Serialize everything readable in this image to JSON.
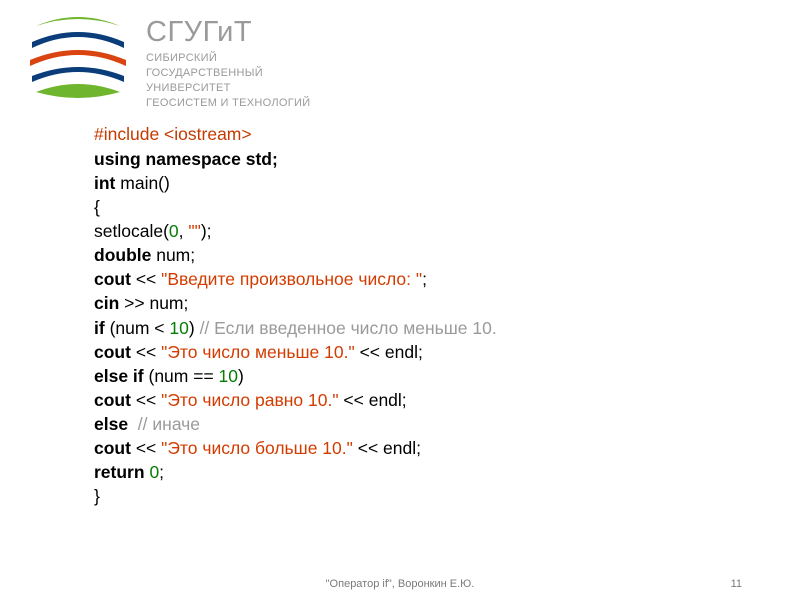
{
  "header": {
    "uni_name": "СГУГиТ",
    "uni_sub_1": "СИБИРСКИЙ",
    "uni_sub_2": "ГОСУДАРСТВЕННЫЙ",
    "uni_sub_3": "УНИВЕРСИТЕТ",
    "uni_sub_4": "ГЕОСИСТЕМ И ТЕХНОЛОГИЙ"
  },
  "code": {
    "l1": "#include <iostream>",
    "l2a": "using namespace std;",
    "l3a": "int",
    "l3b": " main()",
    "l4": "{",
    "l5a": "setlocale(",
    "l5b": "0",
    "l5c": ", ",
    "l5d": "\"\"",
    "l5e": ");",
    "l6a": "double",
    "l6b": " num;",
    "l7a": "cout",
    "l7b": " << ",
    "l7c": "\"Введите произвольное число: \"",
    "l7d": ";",
    "l8a": "cin",
    "l8b": " >> num;",
    "l9a": "if",
    "l9b": " (num < ",
    "l9c": "10",
    "l9d": ") ",
    "l9e": "// Если введенное число меньше 10.",
    "l10a": "cout",
    "l10b": " << ",
    "l10c": "\"Это число меньше 10.\"",
    "l10d": " << endl;",
    "l11a": "else if",
    "l11b": " (num == ",
    "l11c": "10",
    "l11d": ")",
    "l12a": "cout",
    "l12b": " << ",
    "l12c": "\"Это число равно 10.\"",
    "l12d": " << endl;",
    "l13a": "else",
    "l13b": "  ",
    "l13c": "// иначе",
    "l14a": "cout",
    "l14b": " << ",
    "l14c": "\"Это число больше 10.\"",
    "l14d": " << endl;",
    "l15a": "return",
    "l15b": " ",
    "l15c": "0",
    "l15d": ";",
    "l16": "}"
  },
  "footer": {
    "text": "\"Оператор if\", Воронкин Е.Ю.",
    "page": "11"
  }
}
